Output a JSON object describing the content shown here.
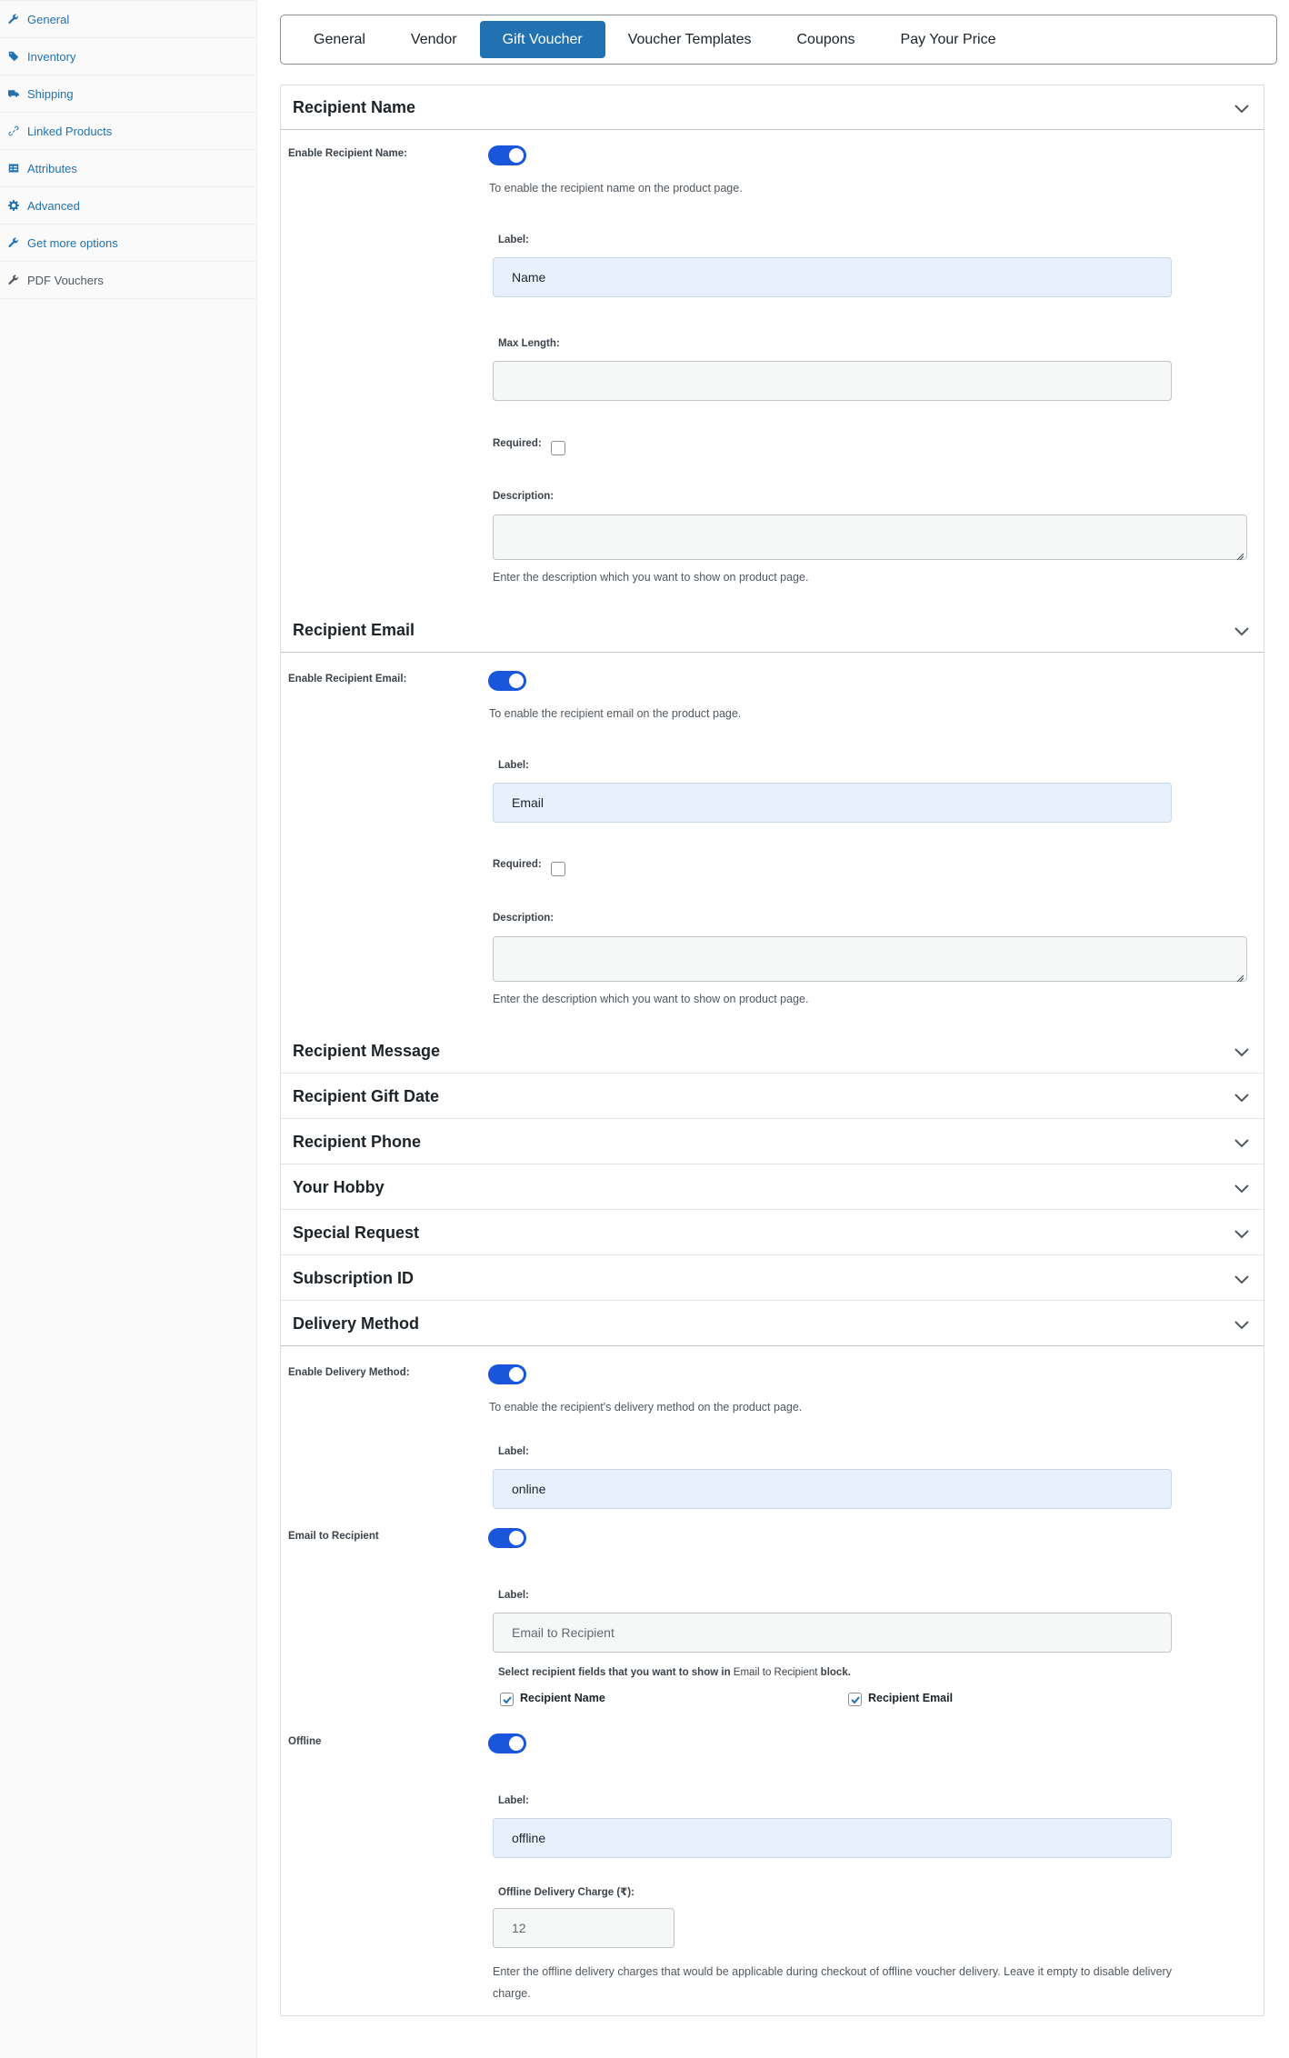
{
  "sidebar": {
    "items": [
      {
        "label": "General",
        "icon": "wrench-icon"
      },
      {
        "label": "Inventory",
        "icon": "tag-icon"
      },
      {
        "label": "Shipping",
        "icon": "truck-icon"
      },
      {
        "label": "Linked Products",
        "icon": "link-icon"
      },
      {
        "label": "Attributes",
        "icon": "table-icon"
      },
      {
        "label": "Advanced",
        "icon": "gear-icon"
      },
      {
        "label": "Get more options",
        "icon": "wrench-icon"
      },
      {
        "label": "PDF Vouchers",
        "icon": "wrench-icon"
      }
    ]
  },
  "tabs": [
    "General",
    "Vendor",
    "Gift Voucher",
    "Voucher Templates",
    "Coupons",
    "Pay Your Price"
  ],
  "active_tab": "Gift Voucher",
  "colors": {
    "accent": "#2271b1",
    "toggle_on": "#1a56db",
    "filled_input": "#e8f0fe"
  },
  "recipient_name": {
    "title": "Recipient Name",
    "enable_label": "Enable Recipient Name:",
    "enable_help": "To enable the recipient name on the product page.",
    "label_label": "Label:",
    "label_value": "Name",
    "max_length_label": "Max Length:",
    "max_length_value": "",
    "required_label": "Required:",
    "description_label": "Description:",
    "description_help": "Enter the description which you want to show on product page."
  },
  "recipient_email": {
    "title": "Recipient Email",
    "enable_label": "Enable Recipient Email:",
    "enable_help": "To enable the recipient email on the product page.",
    "label_label": "Label:",
    "label_value": "Email",
    "required_label": "Required:",
    "description_label": "Description:",
    "description_help": "Enter the description which you want to show on product page."
  },
  "collapsed_sections": [
    "Recipient Message",
    "Recipient Gift Date",
    "Recipient Phone",
    "Your Hobby",
    "Special Request",
    "Subscription ID"
  ],
  "delivery_method": {
    "title": "Delivery Method",
    "enable_label": "Enable Delivery Method:",
    "enable_help": "To enable the recipient's delivery method on the product page.",
    "label_label": "Label:",
    "label_value": "online",
    "email_to_recipient": {
      "label": "Email to Recipient",
      "label_label": "Label:",
      "placeholder": "Email to Recipient",
      "select_text_pre": "Select recipient fields that you want to show in ",
      "select_text_link": "Email to Recipient",
      "select_text_post": " block.",
      "fields": [
        {
          "label": "Recipient Name",
          "checked": true
        },
        {
          "label": "Recipient Email",
          "checked": true
        }
      ]
    },
    "offline": {
      "label": "Offline",
      "label_label": "Label:",
      "label_value": "offline",
      "charge_label": "Offline Delivery Charge (₹):",
      "charge_value": "12",
      "charge_help": "Enter the offline delivery charges that would be applicable during checkout of offline voucher delivery. Leave it empty to disable delivery charge."
    }
  }
}
